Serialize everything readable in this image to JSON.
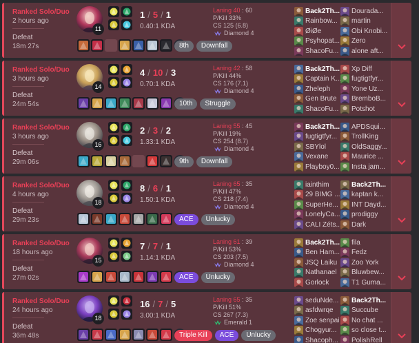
{
  "colors": {
    "card_bg": "#59343c",
    "loss_accent": "#e84057",
    "ace": "#7b4cdc",
    "tag": "#6a6a72"
  },
  "icons": {
    "expand": "chevron-down-icon",
    "rank_diamond": "diamond-rank-icon",
    "rank_emerald": "emerald-rank-icon"
  },
  "matches": [
    {
      "queue": "Ranked Solo/Duo",
      "time_ago": "2 hours ago",
      "result": "Defeat",
      "duration": "18m 27s",
      "level": "11",
      "kills": "1",
      "deaths": "5",
      "assists": "1",
      "ratio": "0.40:1 KDA",
      "laning_label": "Laning 40",
      "laning_sep": " : ",
      "laning_opp": "60",
      "pkill": "P/Kill 33%",
      "cs": "CS 125 (6.8)",
      "rank": "Diamond 4",
      "tags": [
        "8th",
        "Downfall"
      ],
      "team1": [
        "Back2Th...",
        "Rainbow...",
        "ØiØe",
        "Psyhopat...",
        "ShacoFu..."
      ],
      "team2": [
        "Dourada...",
        "martin",
        "Obi Knobi...",
        "Zero",
        "alone aft..."
      ]
    },
    {
      "queue": "Ranked Solo/Duo",
      "time_ago": "3 hours ago",
      "result": "Defeat",
      "duration": "24m 54s",
      "level": "14",
      "kills": "4",
      "deaths": "10",
      "assists": "3",
      "ratio": "0.70:1 KDA",
      "laning_label": "Laning 42",
      "laning_sep": " : ",
      "laning_opp": "58",
      "pkill": "P/Kill 44%",
      "cs": "CS 176 (7.1)",
      "rank": "Diamond 4",
      "tags": [
        "10th",
        "Struggle"
      ],
      "team1": [
        "Back2Th...",
        "Captain K...",
        "Zheleph",
        "Gen Brute",
        "ShacoFu..."
      ],
      "team2": [
        "Xp Diff",
        "fugtigtfyr...",
        "Yone Uz...",
        "BremboB...",
        "Potshot"
      ]
    },
    {
      "queue": "Ranked Solo/Duo",
      "time_ago": "3 hours ago",
      "result": "Defeat",
      "duration": "29m 06s",
      "level": "16",
      "kills": "2",
      "deaths": "3",
      "assists": "2",
      "ratio": "1.33:1 KDA",
      "laning_label": "Laning 55",
      "laning_sep": " : ",
      "laning_opp": "45",
      "pkill": "P/Kill 19%",
      "cs": "CS 254 (8.7)",
      "rank": "Diamond 4",
      "tags": [
        "9th",
        "Downfall"
      ],
      "team1": [
        "Back2Th...",
        "fugtigtfyr...",
        "SBYlol",
        "Vexane",
        "Playboy0..."
      ],
      "team2": [
        "APDSqui...",
        "TrollKing",
        "OldSaggy...",
        "Maurice ...",
        "Insta jam..."
      ]
    },
    {
      "queue": "Ranked Solo/Duo",
      "time_ago": "4 hours ago",
      "result": "Defeat",
      "duration": "29m 23s",
      "level": "18",
      "kills": "8",
      "deaths": "6",
      "assists": "1",
      "ratio": "1.50:1 KDA",
      "laning_label": "Laning 65",
      "laning_sep": " : ",
      "laning_opp": "35",
      "pkill": "P/Kill 47%",
      "cs": "CS 218 (7.4)",
      "rank": "Diamond 4",
      "tags": [
        "ACE",
        "Unlucky"
      ],
      "team1": [
        "iainthim",
        "29 BIMG ...",
        "SuperHe...",
        "LonelyCa...",
        "CALI Zéts..."
      ],
      "team2": [
        "Back2Th...",
        "kaptan k...",
        "INT Dayd...",
        "prodiggy",
        "Dark"
      ]
    },
    {
      "queue": "Ranked Solo/Duo",
      "time_ago": "18 hours ago",
      "result": "Defeat",
      "duration": "27m 02s",
      "level": "15",
      "kills": "7",
      "deaths": "7",
      "assists": "1",
      "ratio": "1.14:1 KDA",
      "laning_label": "Laning 61",
      "laning_sep": " : ",
      "laning_opp": "39",
      "pkill": "P/Kill 53%",
      "cs": "CS 203 (7.5)",
      "rank": "Diamond 4",
      "tags": [
        "ACE",
        "Unlucky"
      ],
      "team1": [
        "Back2Th...",
        "Ben Ham...",
        "JSQ Laiku",
        "Nathanael",
        "Gorlock"
      ],
      "team2": [
        "fila",
        "Fedz",
        "Zoo York",
        "Bluwbew...",
        "T1 Guma..."
      ]
    },
    {
      "queue": "Ranked Solo/Duo",
      "time_ago": "24 hours ago",
      "result": "Defeat",
      "duration": "36m 48s",
      "level": "18",
      "kills": "16",
      "deaths": "7",
      "assists": "5",
      "ratio": "3.00:1 KDA",
      "laning_label": "Laning 65",
      "laning_sep": " : ",
      "laning_opp": "35",
      "pkill": "P/Kill 51%",
      "cs": "CS 267 (7.3)",
      "rank": "Emerald 1",
      "tags": [
        "Triple Kill",
        "ACE",
        "Unlucky"
      ],
      "team1": [
        "seduNde...",
        "asfdwrqe",
        "Zoe senpai",
        "Chogyur...",
        "Shacoph..."
      ],
      "team2": [
        "Back2Th...",
        "Succube",
        "No chat ...",
        "so close t...",
        "PolishRell"
      ]
    }
  ]
}
